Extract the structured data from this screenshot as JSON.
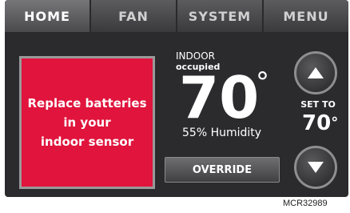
{
  "tabs": [
    {
      "label": "HOME"
    },
    {
      "label": "FAN"
    },
    {
      "label": "SYSTEM"
    },
    {
      "label": "MENU"
    }
  ],
  "alert": {
    "line1": "Replace batteries",
    "line2": "in your",
    "line3": "indoor sensor",
    "color": "#e0143c"
  },
  "indoor": {
    "label": "INDOOR",
    "status": "occupied",
    "temperature": "70",
    "degree_symbol": "°",
    "humidity": "55% Humidity"
  },
  "override_label": "OVERRIDE",
  "setpoint": {
    "label": "SET TO",
    "value": "70",
    "degree_symbol": "°"
  },
  "icons": {
    "up": "arrow-up-icon",
    "down": "arrow-down-icon"
  },
  "caption": "MCR32989"
}
